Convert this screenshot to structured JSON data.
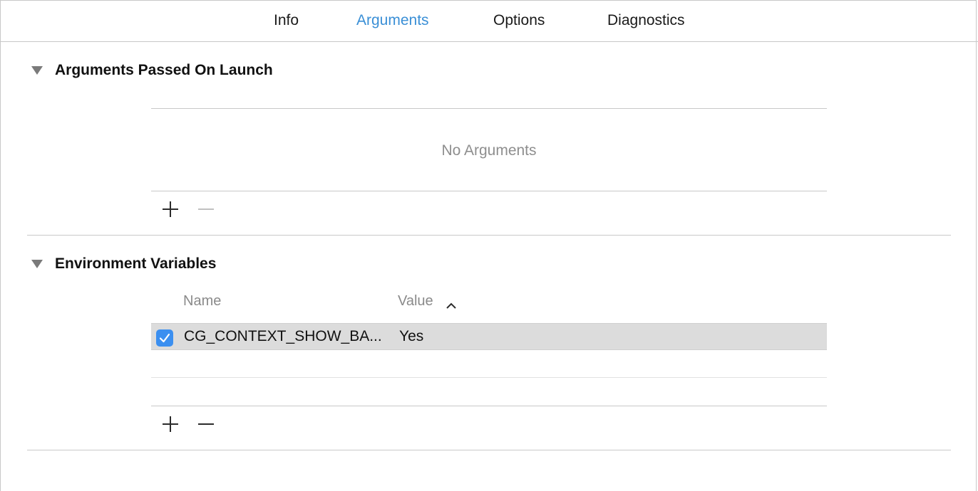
{
  "tabs": [
    {
      "label": "Info",
      "active": false
    },
    {
      "label": "Arguments",
      "active": true
    },
    {
      "label": "Options",
      "active": false
    },
    {
      "label": "Diagnostics",
      "active": false
    }
  ],
  "accent_color": "#3a8fd6",
  "arguments_section": {
    "title": "Arguments Passed On Launch",
    "empty_text": "No Arguments",
    "add_enabled": true,
    "remove_enabled": false
  },
  "env_section": {
    "title": "Environment Variables",
    "columns": {
      "name": "Name",
      "value": "Value"
    },
    "sort_indicator": "chevron-up-icon",
    "rows": [
      {
        "enabled": true,
        "name": "CG_CONTEXT_SHOW_BA...",
        "value": "Yes"
      }
    ],
    "add_enabled": true,
    "remove_enabled": true
  }
}
